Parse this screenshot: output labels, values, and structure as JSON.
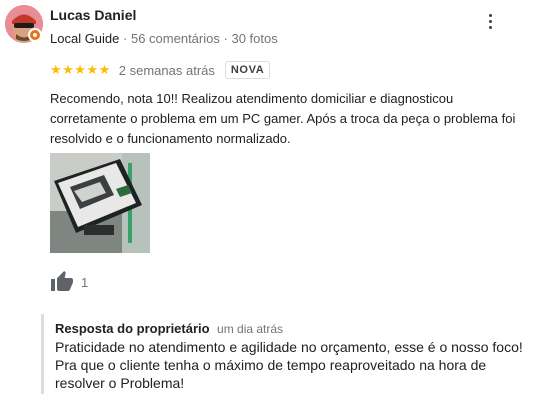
{
  "review": {
    "author": {
      "name": "Lucas Daniel",
      "badge": "Local Guide",
      "separator": "·",
      "reviews_count": "56 comentários",
      "photos_count": "30 fotos",
      "avatar_icon": "avatar-with-sunglasses",
      "badge_icon": "local-guide-badge-icon"
    },
    "more_icon": "more-vert-icon",
    "rating": {
      "stars": 5,
      "max": 5,
      "stars_text": "★★★★★",
      "color": "#fbbc04"
    },
    "date": "2 semanas atrás",
    "new_label": "NOVA",
    "text": "Recomendo, nota 10!! Realizou atendimento domiciliar e diagnosticou corretamente o problema em um PC gamer. Após a troca da peça o problema foi resolvido e o funcionamento normalizado.",
    "photo_icon": "power-supply-photo",
    "likes": {
      "icon": "thumbs-up-icon",
      "count": "1"
    }
  },
  "owner_reply": {
    "title": "Resposta do proprietário",
    "date": "um dia atrás",
    "text": "Praticidade no atendimento e agilidade no orçamento, esse é o nosso foco! Pra que o cliente tenha o máximo de tempo reaproveitado na hora de resolver o Problema!"
  },
  "colors": {
    "star": "#fbbc04",
    "secondary_text": "#70757a",
    "badge_orange": "#e8711a",
    "reply_bar": "#dadce0"
  }
}
